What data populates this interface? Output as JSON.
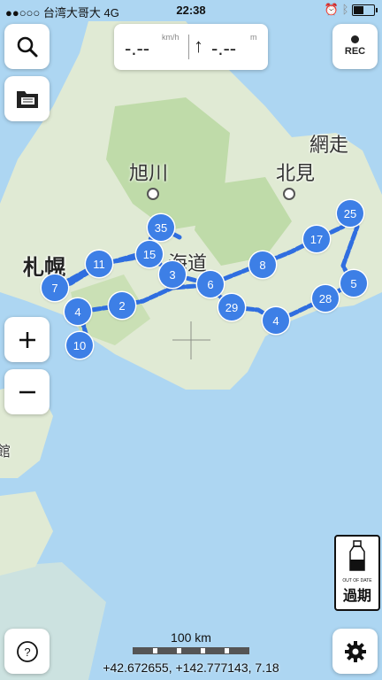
{
  "status_bar": {
    "carrier": "●●○○○ 台湾大哥大  4G",
    "time": "22:38"
  },
  "speed": {
    "value": "-.--",
    "unit": "km/h",
    "altitude_value": "-.--",
    "altitude_unit": "m"
  },
  "rec_label": "REC",
  "map_labels": {
    "sapporo": "札幌",
    "asahikawa": "旭川",
    "kitami": "北見",
    "abashiri": "網走",
    "hokkaido": "海道",
    "hakodate_partial": "館"
  },
  "route_markers": [
    "35",
    "15",
    "11",
    "7",
    "3",
    "6",
    "8",
    "17",
    "25",
    "5",
    "28",
    "4",
    "29",
    "2",
    "4",
    "10"
  ],
  "out_of_date": {
    "small": "OUT OF DATE",
    "big": "過期"
  },
  "scale_label": "100 km",
  "coords": "+42.672655, +142.777143, 7.18",
  "colors": {
    "route": "#2f6ee0",
    "marker": "#3d7fe6",
    "water": "#a8d4f2",
    "land": "#dfe9d2",
    "forest": "#bcd9a4"
  }
}
